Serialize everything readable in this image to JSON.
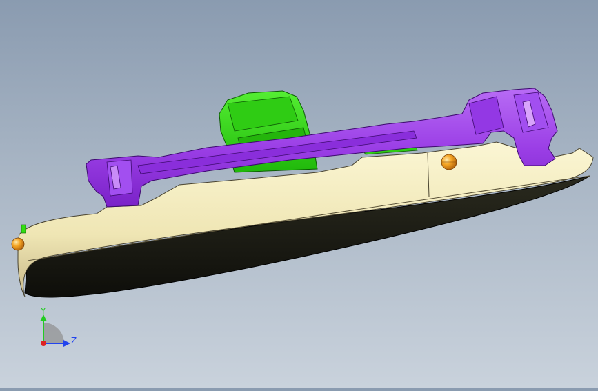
{
  "viewport": {
    "background_top": "#8a9bb0",
    "background_bottom": "#c9d2dc"
  },
  "model": {
    "parts": [
      {
        "name": "sole-base",
        "color": "#f5eec2"
      },
      {
        "name": "sole-underside",
        "color": "#1c1c14"
      },
      {
        "name": "frame-bracket",
        "color": "#9b3fe6"
      },
      {
        "name": "clip-part",
        "color": "#33dd11"
      },
      {
        "name": "marker-ball",
        "color": "#f0a020"
      }
    ]
  },
  "triad": {
    "y_label": "Y",
    "z_label": "Z",
    "y_color": "#22cc22",
    "z_color": "#2244ee",
    "x_color": "#dd2222"
  }
}
